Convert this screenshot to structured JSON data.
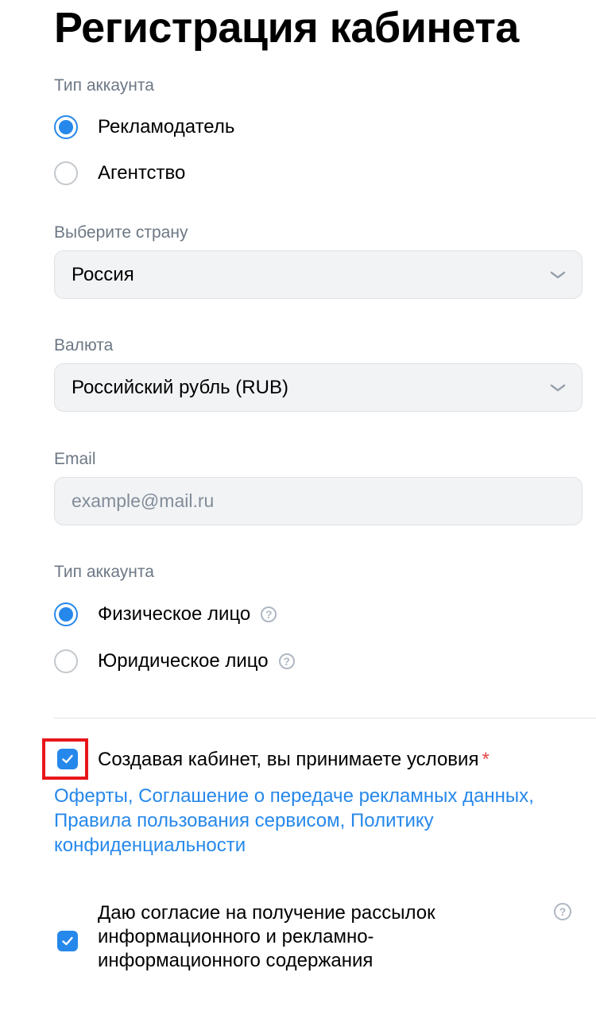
{
  "page": {
    "title": "Регистрация кабинета"
  },
  "account_type": {
    "label": "Тип аккаунта",
    "options": [
      {
        "label": "Рекламодатель",
        "checked": true
      },
      {
        "label": "Агентство",
        "checked": false
      }
    ]
  },
  "country": {
    "label": "Выберите страну",
    "value": "Россия"
  },
  "currency": {
    "label": "Валюта",
    "value": "Российский рубль (RUB)"
  },
  "email": {
    "label": "Email",
    "value": "",
    "placeholder": "example@mail.ru"
  },
  "legal_type": {
    "label": "Тип аккаунта",
    "options": [
      {
        "label": "Физическое лицо",
        "checked": true,
        "help": "?"
      },
      {
        "label": "Юридическое лицо",
        "checked": false,
        "help": "?"
      }
    ]
  },
  "terms": {
    "checked": true,
    "text": "Создавая кабинет, вы принимаете условия",
    "required_mark": "*",
    "links": [
      "Оферты",
      "Соглашение о передаче рекламных данных",
      "Правила пользования сервисом",
      "Политику конфиденциальности"
    ],
    "separator": ", "
  },
  "consent": {
    "checked": true,
    "text": "Даю согласие на получение рассылок информационного и рекламно-информационного содержания",
    "help": "?"
  },
  "icons": {
    "chevron": "chevron-down-icon",
    "check": "check-icon",
    "help": "question-circle-icon"
  },
  "colors": {
    "accent": "#2688eb",
    "highlight": "#e8171b",
    "required": "#e64646",
    "secondary_text": "#6d7885"
  }
}
